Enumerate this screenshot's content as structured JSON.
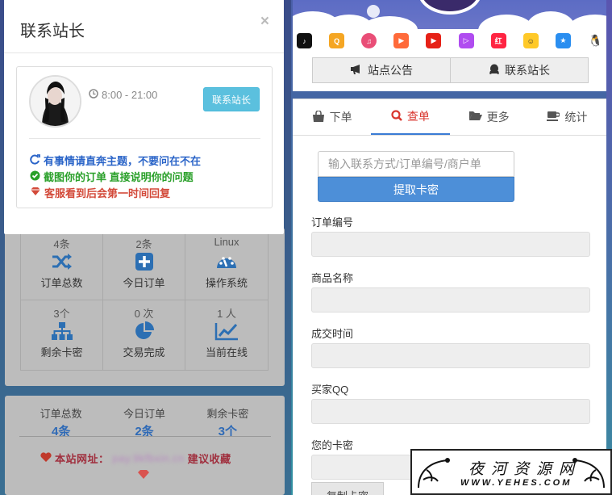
{
  "modal": {
    "title": "联系站长",
    "close": "×",
    "hours": "8:00 - 21:00",
    "contact_button": "联系站长",
    "notes": [
      "有事情请直奔主题，不要问在不在",
      "截图你的订单 直接说明你的问题",
      "客服看到后会第一时间回复"
    ]
  },
  "stats": [
    {
      "value": "4条",
      "label": "订单总数",
      "icon": "shuffle-icon"
    },
    {
      "value": "2条",
      "label": "今日订单",
      "icon": "plus-square-icon"
    },
    {
      "value": "Linux",
      "label": "操作系统",
      "icon": "dashboard-icon"
    },
    {
      "value": "3个",
      "label": "剩余卡密",
      "icon": "sitemap-icon"
    },
    {
      "value": "0 次",
      "label": "交易完成",
      "icon": "pie-chart-icon"
    },
    {
      "value": "1 人",
      "label": "当前在线",
      "icon": "line-chart-icon"
    }
  ],
  "summary": [
    {
      "label": "订单总数",
      "value": "4条"
    },
    {
      "label": "今日订单",
      "value": "2条"
    },
    {
      "label": "剩余卡密",
      "value": "3个"
    }
  ],
  "site": {
    "prefix": "本站网址：",
    "url": "pay.9kfbxin.cn",
    "suffix": "建议收藏"
  },
  "top_nav": {
    "announcement": "站点公告",
    "contact": "联系站长"
  },
  "apps": [
    "tiktok-icon",
    "qmusic-icon",
    "music-icon",
    "listen-icon",
    "youtube-icon",
    "video-icon",
    "redbook-icon",
    "face-icon",
    "star-icon",
    "qq-icon"
  ],
  "tabs": [
    {
      "label": "下单",
      "icon": "shopping-bag-icon"
    },
    {
      "label": "查单",
      "icon": "search-icon"
    },
    {
      "label": "更多",
      "icon": "folder-open-icon"
    },
    {
      "label": "统计",
      "icon": "coffee-icon"
    }
  ],
  "search": {
    "placeholder": "输入联系方式/订单编号/商户单",
    "button": "提取卡密"
  },
  "fields": [
    {
      "label": "订单编号"
    },
    {
      "label": "商品名称"
    },
    {
      "label": "成交时间"
    },
    {
      "label": "买家QQ"
    },
    {
      "label": "您的卡密"
    }
  ],
  "copy_button": "复制卡密",
  "watermark": {
    "title": "夜河资源网",
    "url": "WWW.YEHES.COM"
  }
}
